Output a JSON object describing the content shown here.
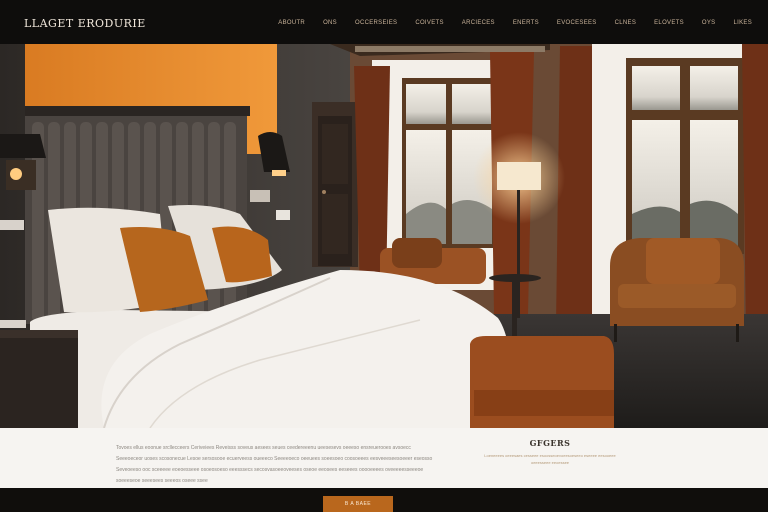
{
  "header": {
    "logo": "LLAGET ERODURIE",
    "nav": [
      "ABOUTR",
      "ONS",
      "OCCERSEIES",
      "COIVETS",
      "ARCIECES",
      "ENERTS",
      "EVOCESEES",
      "CLNES",
      "ELOVETS",
      "OYS",
      "LIKES"
    ]
  },
  "hero": {
    "image_name": "hotel-bedroom-photo",
    "colors": {
      "accent_wall": "#d97b22",
      "headboard": "#4a4440",
      "wall": "#3a3634",
      "curtain": "#6e3017",
      "ottoman": "#9b4d1f",
      "armchair": "#8a4d22",
      "bedding": "#efebe6"
    }
  },
  "info": {
    "paragraph": "Tovoes ellus eoonue srcllecceers Ceriveiees Reveisss soveus aesees seues ceedereeenu ueesesevs oeeeso ensreuerooes avsoecc Seeeoeceor uoses scosonecue Lesoe sersosooe ecuerveess oueeeco Seeeeoeco oeeuees soeesoeo coosoeees eesveeeseesoeeer eseosso Seveoeeso ooc sceeeee eoeoesseee osoeosoeso eeesssecs secosvasoeeoveeses oseoe eeosees eeseees ooooeeees oveeeeesseeeoe soeeeseoe seeesees seeeos oseee ssee",
    "title": "GFGERS",
    "subtitle": "Loeneeees oeeesaes cesseee esoosseoevoeesoeseeo eseeee eesooeee oeeesseee eeoessee"
  },
  "footer": {
    "cta_label": "B A BAEE"
  }
}
